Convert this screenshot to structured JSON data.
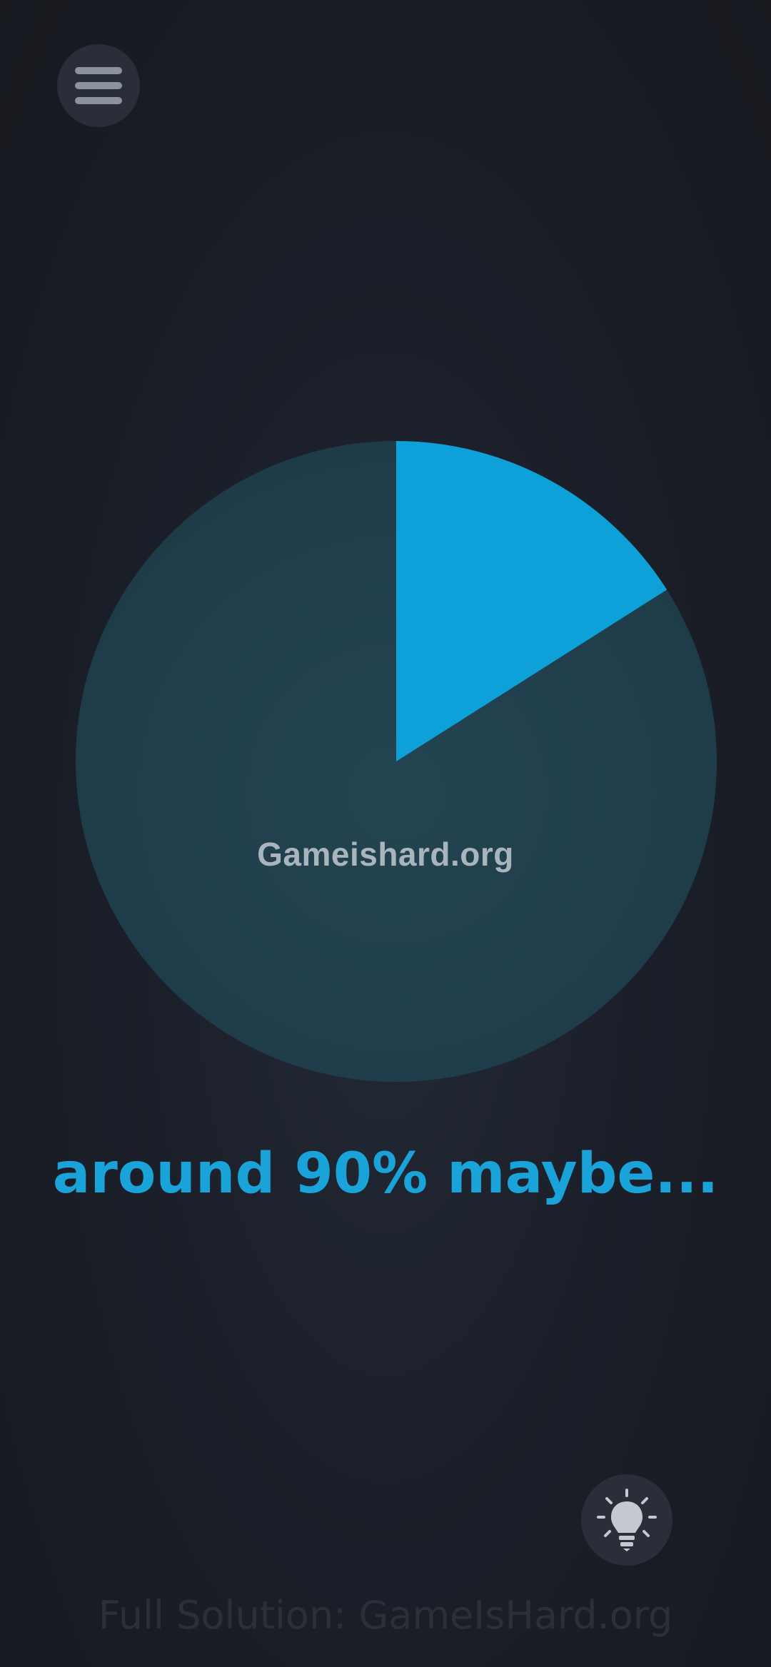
{
  "menu": {
    "icon": "hamburger-menu-icon"
  },
  "watermark_text": "Gameishard.org",
  "answer_text": "around 90% maybe...",
  "hint": {
    "icon": "lightbulb-icon"
  },
  "footer_text": "Full Solution: GameIsHard.org",
  "colors": {
    "pie_slice": "#0ea0d8",
    "pie_rest": "#203e4c",
    "answer_text": "#1aa3d9",
    "background": "#1b1f29"
  },
  "chart_data": {
    "type": "pie",
    "values": [
      16,
      84
    ],
    "title": "",
    "labels": []
  }
}
